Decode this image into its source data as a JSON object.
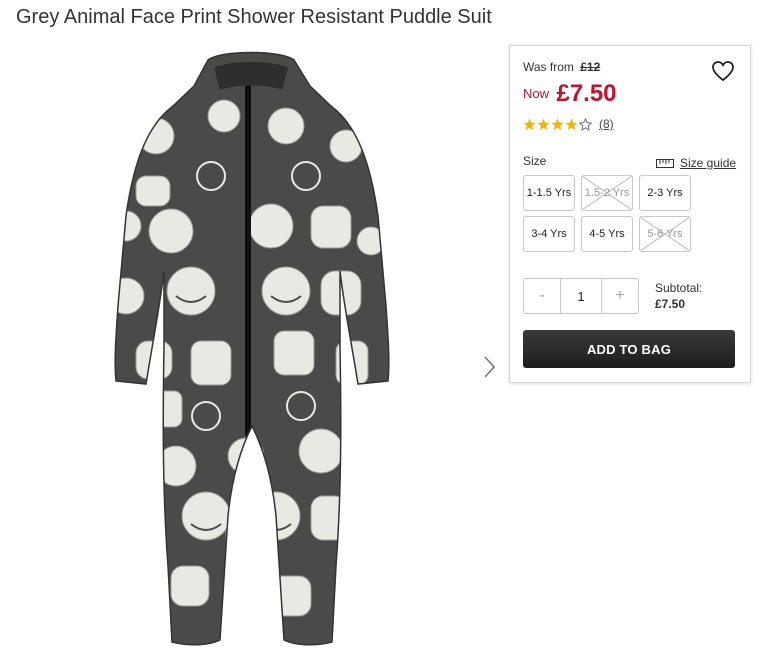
{
  "product": {
    "title": "Grey Animal Face Print Shower Resistant Puddle Suit",
    "image_icon": "animal-print-puddle-suit-image"
  },
  "pricing": {
    "was_label": "Was from",
    "was_price": "£12",
    "now_label": "Now",
    "now_price": "£7.50",
    "now_color": "#c8102e"
  },
  "rating": {
    "stars_filled": 4,
    "stars_total": 5,
    "review_count": "(8)",
    "star_color": "#f5b301"
  },
  "size": {
    "label": "Size",
    "guide_label": "Size guide",
    "options": [
      {
        "label": "1-1.5 Yrs",
        "available": true
      },
      {
        "label": "1.5-2 Yrs",
        "available": false
      },
      {
        "label": "2-3 Yrs",
        "available": true
      },
      {
        "label": "3-4 Yrs",
        "available": true
      },
      {
        "label": "4-5 Yrs",
        "available": true
      },
      {
        "label": "5-6 Yrs",
        "available": false
      }
    ]
  },
  "quantity": {
    "minus": "-",
    "value": "1",
    "plus": "+"
  },
  "subtotal": {
    "label": "Subtotal:",
    "amount": "£7.50"
  },
  "cta": {
    "add_to_bag": "ADD TO BAG"
  },
  "icons": {
    "wishlist": "heart-icon",
    "next": "chevron-right-icon",
    "size_guide": "ruler-icon"
  }
}
